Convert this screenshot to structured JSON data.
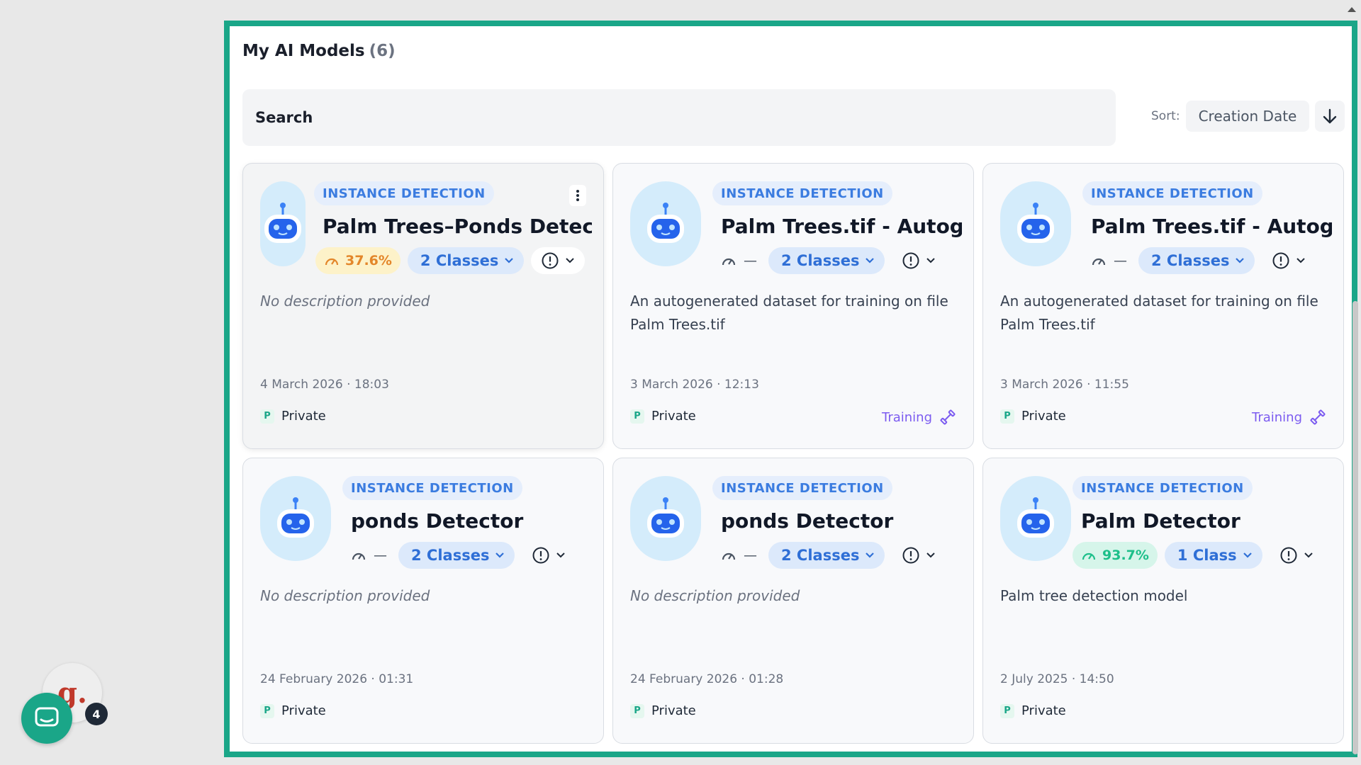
{
  "page": {
    "title": "My AI Models",
    "count": "(6)",
    "search_placeholder": "Search",
    "sort_label": "Sort:",
    "sort_value": "Creation Date"
  },
  "cards": [
    {
      "type": "INSTANCE DETECTION",
      "name": "Palm Trees–Ponds Detector",
      "accuracy": "37.6%",
      "classes": "2 Classes",
      "description": "No description provided",
      "date": "4 March 2026 · 18:03",
      "privacy": "Private",
      "status": ""
    },
    {
      "type": "INSTANCE DETECTION",
      "name": "Palm Trees.tif - Autogene",
      "accuracy": "—",
      "classes": "2 Classes",
      "description": "An autogenerated dataset for training on file Palm Trees.tif",
      "date": "3 March 2026 · 12:13",
      "privacy": "Private",
      "status": "Training"
    },
    {
      "type": "INSTANCE DETECTION",
      "name": "Palm Trees.tif - Autogene",
      "accuracy": "—",
      "classes": "2 Classes",
      "description": "An autogenerated dataset for training on file Palm Trees.tif",
      "date": "3 March 2026 · 11:55",
      "privacy": "Private",
      "status": "Training"
    },
    {
      "type": "INSTANCE DETECTION",
      "name": "ponds Detector",
      "accuracy": "—",
      "classes": "2 Classes",
      "description": "No description provided",
      "date": "24 February 2026 · 01:31",
      "privacy": "Private",
      "status": ""
    },
    {
      "type": "INSTANCE DETECTION",
      "name": "ponds Detector",
      "accuracy": "—",
      "classes": "2 Classes",
      "description": "No description provided",
      "date": "24 February 2026 · 01:28",
      "privacy": "Private",
      "status": ""
    },
    {
      "type": "INSTANCE DETECTION",
      "name": "Palm Detector",
      "accuracy": "93.7%",
      "classes": "1 Class",
      "description": "Palm tree detection model",
      "date": "2 July 2025 · 14:50",
      "privacy": "Private",
      "status": ""
    }
  ],
  "widgets": {
    "chat_icon": "chat-icon",
    "g_label": "g.",
    "g_badge": "4"
  },
  "colors": {
    "brand": "#1aa688",
    "tag_text": "#3b7ce0",
    "class_pill": "#2f6fd6",
    "accuracy_low": "#e3862a",
    "accuracy_high": "#1dbf8a",
    "training": "#7c5cf0"
  }
}
